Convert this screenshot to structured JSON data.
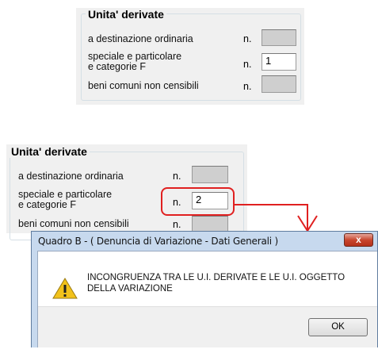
{
  "top_group": {
    "title": "Unita' derivate",
    "rows": [
      {
        "label": "a destinazione ordinaria",
        "n": "n.",
        "value": "",
        "enabled": false
      },
      {
        "label_line1": "speciale e particolare",
        "label_line2": "e categorie F",
        "n": "n.",
        "value": "1",
        "enabled": true
      },
      {
        "label": "beni comuni non censibili",
        "n": "n.",
        "value": "",
        "enabled": false
      }
    ]
  },
  "bottom_group": {
    "title": "Unita' derivate",
    "rows": [
      {
        "label": "a destinazione ordinaria",
        "n": "n.",
        "value": "",
        "enabled": false
      },
      {
        "label_line1": "speciale e particolare",
        "label_line2": "e categorie F",
        "n": "n.",
        "value": "2",
        "enabled": true
      },
      {
        "label": "beni comuni non censibili",
        "n": "n.",
        "value": "",
        "enabled": false
      }
    ]
  },
  "annotation": {
    "color": "#e02020"
  },
  "dialog": {
    "title": "Quadro B - ( Denuncia di Variazione - Dati Generali )",
    "close_label": "x",
    "message": "INCONGRUENZA TRA LE U.I. DERIVATE E LE U.I. OGGETTO DELLA VARIAZIONE",
    "icon": "warning-icon",
    "ok_label": "OK"
  }
}
